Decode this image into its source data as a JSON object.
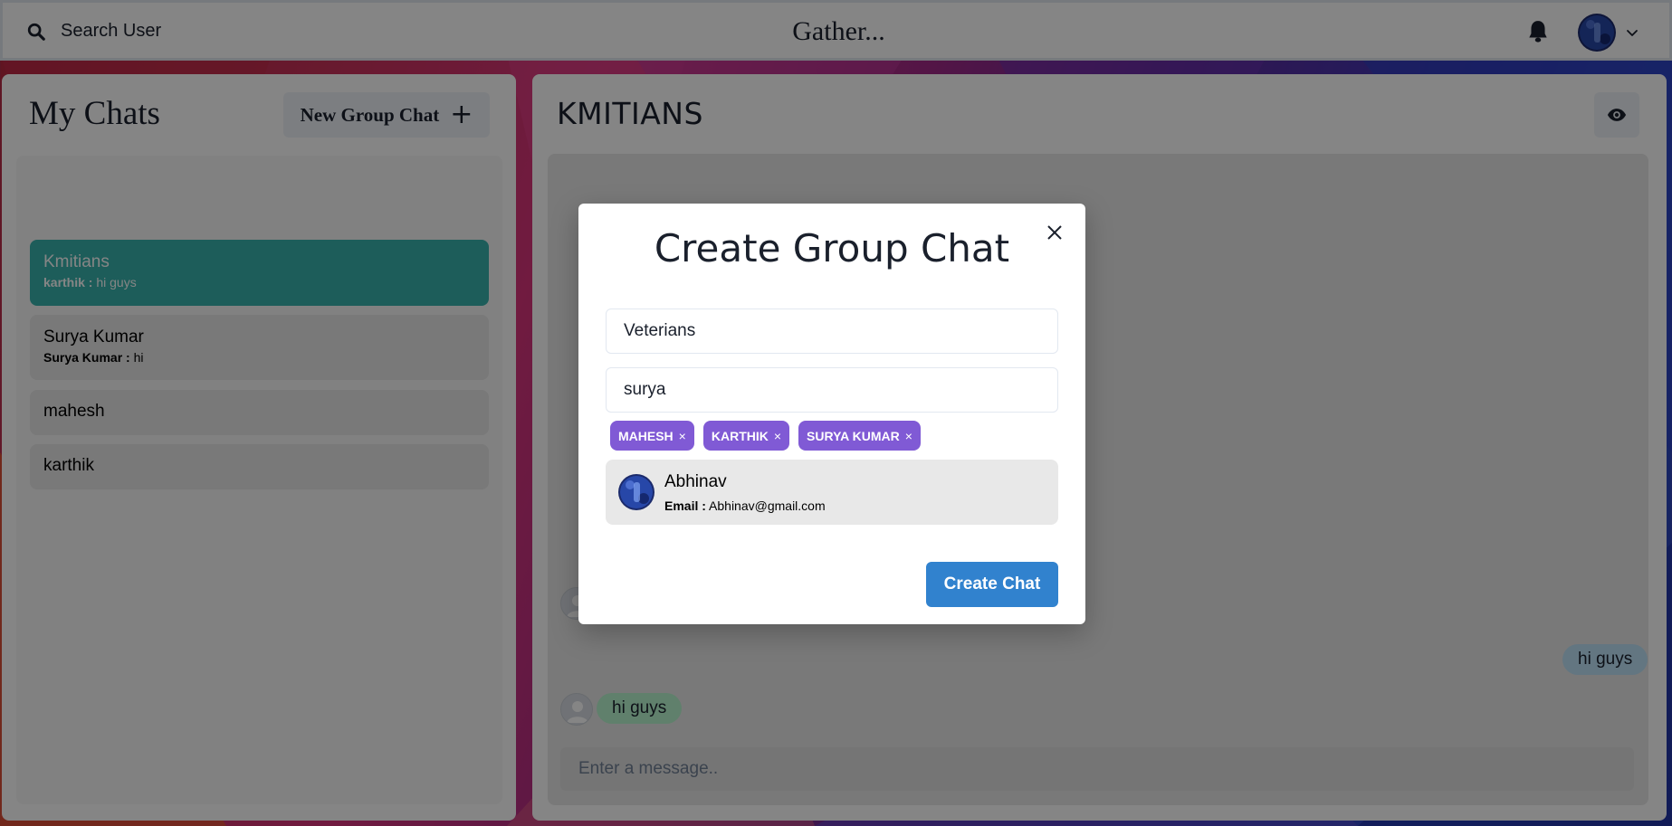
{
  "header": {
    "search_label": "Search User",
    "brand": "Gather...",
    "icons": {
      "search": "search-icon",
      "bell": "bell-icon",
      "chevron": "chevron-down-icon"
    }
  },
  "sidebar": {
    "title": "My Chats",
    "new_group_label": "New Group Chat",
    "new_group_icon": "+",
    "chats": [
      {
        "name": "Kmitians",
        "sender": "karthik :",
        "message": "hi guys",
        "active": true
      },
      {
        "name": "Surya Kumar",
        "sender": "Surya Kumar :",
        "message": "hi",
        "active": false
      },
      {
        "name": "mahesh",
        "active": false
      },
      {
        "name": "karthik",
        "active": false
      }
    ]
  },
  "chat": {
    "title": "KMITIANS",
    "messages": [
      {
        "text": "hi guys",
        "side": "right"
      },
      {
        "text": "hi guys",
        "side": "left"
      }
    ],
    "input_placeholder": "Enter a message.."
  },
  "modal": {
    "title": "Create Group Chat",
    "group_name_value": "Veterians",
    "search_value": "surya",
    "selected_users": [
      "MAHESH",
      "KARTHIK",
      "SURYA KUMAR"
    ],
    "chip_remove_glyph": "×",
    "result": {
      "name": "Abhinav",
      "email_label": "Email :",
      "email": "Abhinav@gmail.com"
    },
    "create_label": "Create Chat",
    "close_glyph": "✕"
  },
  "colors": {
    "active_chat": "#38b2ac",
    "chip": "#805ad5",
    "primary_button": "#3182ce",
    "bubble_incoming": "#b9f5d0",
    "bubble_outgoing": "#bee3f8"
  }
}
